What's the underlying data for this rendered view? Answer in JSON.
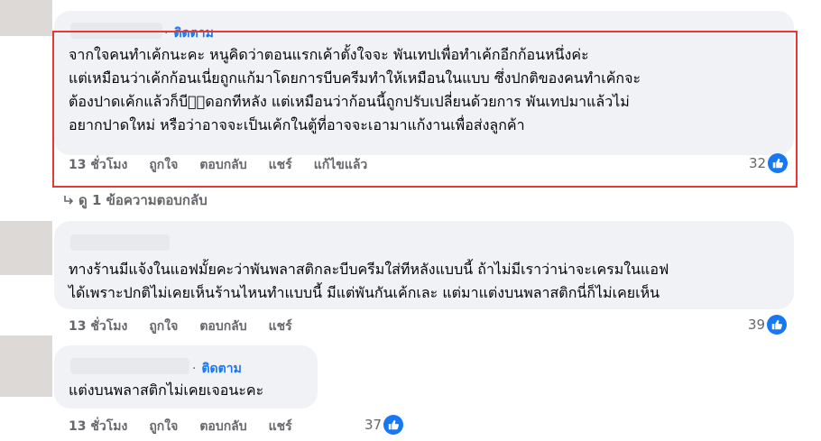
{
  "comments": [
    {
      "follow_label": "ติดตาม",
      "lines": [
        "จากใจคนทำเค้กนะคะ หนูคิดว่าตอนแรกเค้าตั้งใจจะ พันเทปเพื่อทำเค้กอีกก้อนหนึ่งค่ะ",
        "แต่เหมือนว่าเค้กก้อนเนี่ยถูกแก้มาโดยการบีบครีมทำให้เหมือนในแบบ ซึ่งปกติของคนทำเค้กจะ",
        "ต้องปาดเค้กแล้วก็บีบ⃞ดอกทีหลัง แต่เหมือนว่าก้อนนี้ถูกปรับเปลี่ยนด้วยการ พันเทปมาแล้วไม่",
        "อยากปาดใหม่ หรือว่าอาจจะเป็นเค้กในตู้ที่อาจจะเอามาแก้งานเพื่อส่งลูกค้า"
      ],
      "time": "13 ชั่วโมง",
      "like": "ถูกใจ",
      "reply": "ตอบกลับ",
      "share": "แชร์",
      "edited": "แก้ไขแล้ว",
      "reaction_count": "32"
    },
    {
      "lines": [
        "ทางร้านมีแจ้งในแอฟมั้ยคะว่าพันพลาสติกละบีบครีมใส่ทีหลังแบบนี้ ถ้าไม่มีเราว่าน่าจะเครมในแอฟ",
        "ได้เพราะปกติไม่เคยเห็นร้านไหนทำแบบนี้ มีแต่พันกันเค้กเละ แต่มาแต่งบนพลาสติกนี่ก็ไม่เคยเห็น"
      ],
      "time": "13 ชั่วโมง",
      "like": "ถูกใจ",
      "reply": "ตอบกลับ",
      "share": "แชร์",
      "reaction_count": "39"
    },
    {
      "follow_label": "ติดตาม",
      "lines": [
        "แต่งบนพลาสติกไม่เคยเจอนะคะ"
      ],
      "time": "13 ชั่วโมง",
      "like": "ถูกใจ",
      "reply": "ตอบกลับ",
      "share": "แชร์",
      "reaction_count": "37"
    }
  ],
  "view_replies": "ดู 1 ข้อความตอบกลับ",
  "colors": {
    "highlight": "#e53935",
    "link": "#1877f2",
    "muted": "#65676b",
    "bubble": "#f0f2f5"
  },
  "icons": {
    "reaction": "thumbs-up-icon",
    "reply_arrow": "reply-arrow-icon"
  }
}
